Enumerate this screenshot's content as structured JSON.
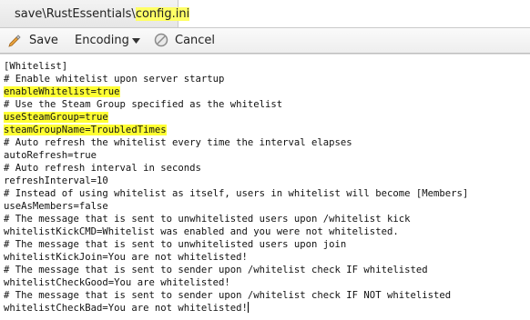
{
  "tab": {
    "path_prefix": "save\\RustEssentials\\",
    "filename": "config.ini"
  },
  "toolbar": {
    "save_label": "Save",
    "encoding_label": "Encoding",
    "cancel_label": "Cancel"
  },
  "editor": {
    "lines": [
      "[Whitelist]",
      "# Enable whitelist upon server startup",
      "enableWhitelist=true",
      "# Use the Steam Group specified as the whitelist",
      "useSteamGroup=true",
      "steamGroupName=TroubledTimes",
      "# Auto refresh the whitelist every time the interval elapses",
      "autoRefresh=true",
      "# Auto refresh interval in seconds",
      "refreshInterval=10",
      "# Instead of using whitelist as itself, users in whitelist will become [Members]",
      "useAsMembers=false",
      "# The message that is sent to unwhitelisted users upon /whitelist kick",
      "whitelistKickCMD=Whitelist was enabled and you were not whitelisted.",
      "# The message that is sent to unwhitelisted users upon join",
      "whitelistKickJoin=You are not whitelisted!",
      "# The message that is sent to sender upon /whitelist check IF whitelisted",
      "whitelistCheckGood=You are whitelisted!",
      "# The message that is sent to sender upon /whitelist check IF NOT whitelisted",
      "whitelistCheckBad=You are not whitelisted!"
    ],
    "highlighted_lines": [
      2,
      4,
      5
    ],
    "highlight_color": "#ffff33"
  }
}
